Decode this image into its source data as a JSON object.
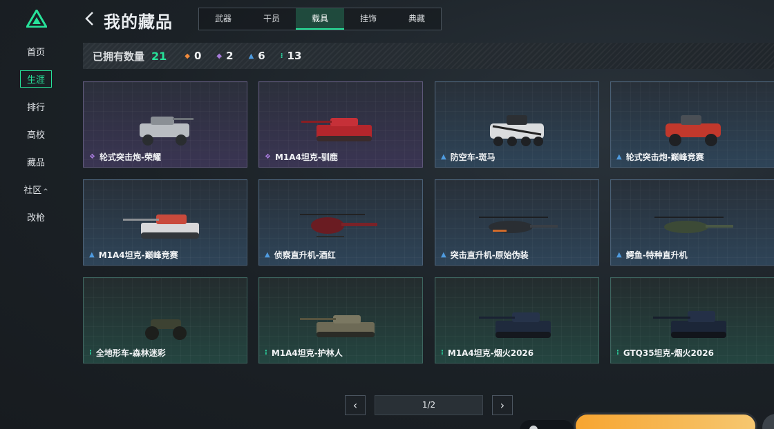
{
  "nav": {
    "items": [
      {
        "label": "首页"
      },
      {
        "label": "生涯"
      },
      {
        "label": "排行"
      },
      {
        "label": "高校"
      },
      {
        "label": "藏品"
      },
      {
        "label": "社区"
      },
      {
        "label": "改枪"
      }
    ],
    "active": "生涯"
  },
  "header": {
    "title": "我的藏品",
    "tabs": [
      {
        "label": "武器"
      },
      {
        "label": "干员"
      },
      {
        "label": "载具"
      },
      {
        "label": "挂饰"
      },
      {
        "label": "典藏"
      }
    ],
    "active_tab": "载具"
  },
  "stats": {
    "label": "已拥有数量",
    "total": "21",
    "items": [
      {
        "value": "0",
        "rarity": "orange"
      },
      {
        "value": "2",
        "rarity": "purple"
      },
      {
        "value": "6",
        "rarity": "blue"
      },
      {
        "value": "13",
        "rarity": "teal"
      }
    ]
  },
  "cards": [
    {
      "name": "轮式突击炮-荣耀",
      "rarity": "purple"
    },
    {
      "name": "M1A4坦克-驯鹿",
      "rarity": "purple"
    },
    {
      "name": "防空车-斑马",
      "rarity": "blue"
    },
    {
      "name": "轮式突击炮-巅峰竞赛",
      "rarity": "blue"
    },
    {
      "name": "M1A4坦克-巅峰竞赛",
      "rarity": "blue"
    },
    {
      "name": "侦察直升机-酒红",
      "rarity": "blue"
    },
    {
      "name": "突击直升机-原始伪装",
      "rarity": "blue"
    },
    {
      "name": "鳄鱼-特种直升机",
      "rarity": "blue"
    },
    {
      "name": "全地形车-森林迷彩",
      "rarity": "teal"
    },
    {
      "name": "M1A4坦克-护林人",
      "rarity": "teal"
    },
    {
      "name": "M1A4坦克-烟火2026",
      "rarity": "teal"
    },
    {
      "name": "GTQ35坦克-烟火2026",
      "rarity": "teal"
    }
  ],
  "pagination": {
    "page": "1/2",
    "prev_icon": "chevron-left-icon",
    "next_icon": "chevron-right-icon"
  },
  "colors": {
    "accent": "#27e39a",
    "orange": "#f08a3c",
    "purple": "#a77bdb",
    "blue": "#4f9bdf",
    "teal": "#2bd8a2"
  }
}
